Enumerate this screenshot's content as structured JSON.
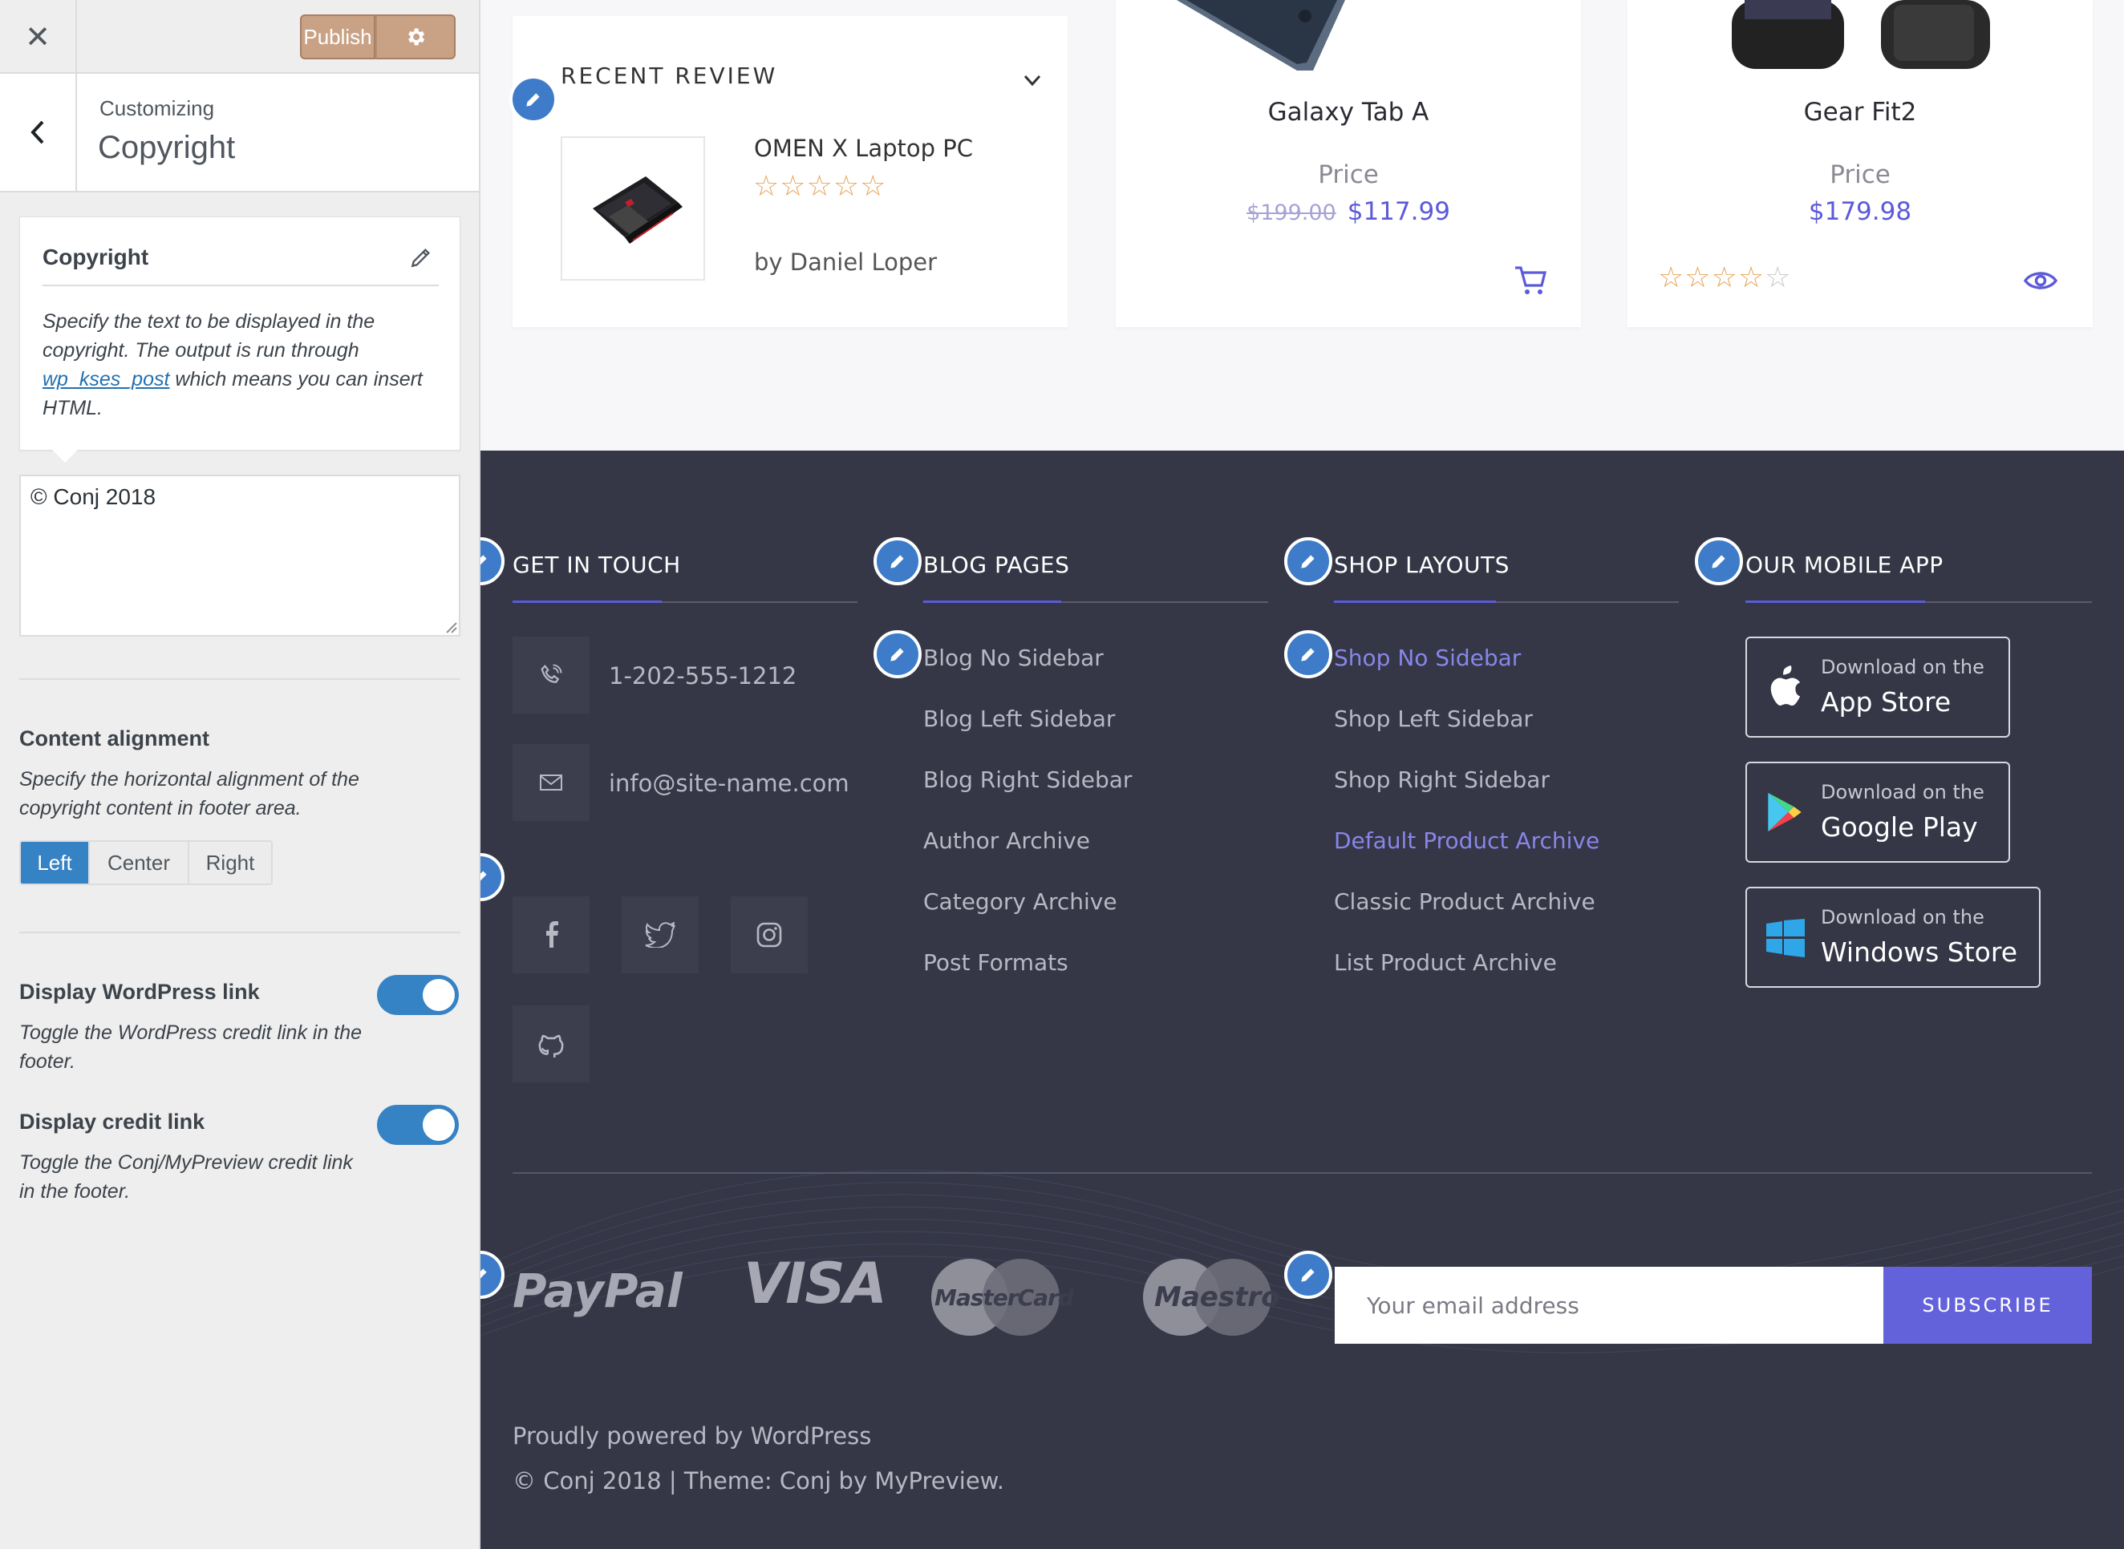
{
  "customizer": {
    "publish_label": "Publish",
    "customizing_label": "Customizing",
    "section_title": "Copyright",
    "description": {
      "title": "Copyright",
      "text_before": "Specify the text to be displayed in the copyright. The output is run through ",
      "link_text": "wp_kses_post",
      "text_after": " which means you can insert HTML."
    },
    "copyright_value": "© Conj 2018",
    "alignment": {
      "title": "Content alignment",
      "description": "Specify the horizontal alignment of the copyright content in footer area.",
      "options": [
        "Left",
        "Center",
        "Right"
      ],
      "selected": "Left"
    },
    "wp_link": {
      "title": "Display WordPress link",
      "description": "Toggle the WordPress credit link in the footer.",
      "enabled": true
    },
    "credit_link": {
      "title": "Display credit link",
      "description": "Toggle the Conj/MyPreview credit link in the footer.",
      "enabled": true
    }
  },
  "preview": {
    "review": {
      "title": "RECENT REVIEW",
      "product": "OMEN X Laptop PC",
      "rating": 0,
      "author": "by Daniel Loper"
    },
    "products": [
      {
        "name": "Galaxy Tab A",
        "price_label": "Price",
        "old_price": "$199.00",
        "price": "$117.99"
      },
      {
        "name": "Gear Fit2",
        "price_label": "Price",
        "price": "$179.98",
        "rating": 4
      }
    ],
    "footer": {
      "contact": {
        "title": "GET IN TOUCH",
        "phone": "1-202-555-1212",
        "email": "info@site-name.com"
      },
      "blog": {
        "title": "BLOG PAGES",
        "links": [
          "Blog No Sidebar",
          "Blog Left Sidebar",
          "Blog Right Sidebar",
          "Author Archive",
          "Category Archive",
          "Post Formats"
        ]
      },
      "shop": {
        "title": "SHOP LAYOUTS",
        "links": [
          "Shop No Sidebar",
          "Shop Left Sidebar",
          "Shop Right Sidebar",
          "Default Product Archive",
          "Classic Product Archive",
          "List Product Archive"
        ]
      },
      "app": {
        "title": "OUR MOBILE APP",
        "stores": [
          {
            "small": "Download on the",
            "big": "App Store"
          },
          {
            "small": "Download on the",
            "big": "Google Play"
          },
          {
            "small": "Download on the",
            "big": "Windows Store"
          }
        ]
      },
      "payments": [
        "PayPal",
        "VISA",
        "MasterCard",
        "Maestro"
      ],
      "newsletter": {
        "placeholder": "Your email address",
        "button": "SUBSCRIBE"
      },
      "powered_by": "Proudly powered by WordPress",
      "copyright_line": "© Conj 2018 | Theme: Conj by MyPreview."
    },
    "colors": {
      "accent": "#5c5ad9",
      "footer_bg": "#353746",
      "edit_pencil": "#3e7cc9",
      "wp_blue": "#3582c4"
    }
  }
}
